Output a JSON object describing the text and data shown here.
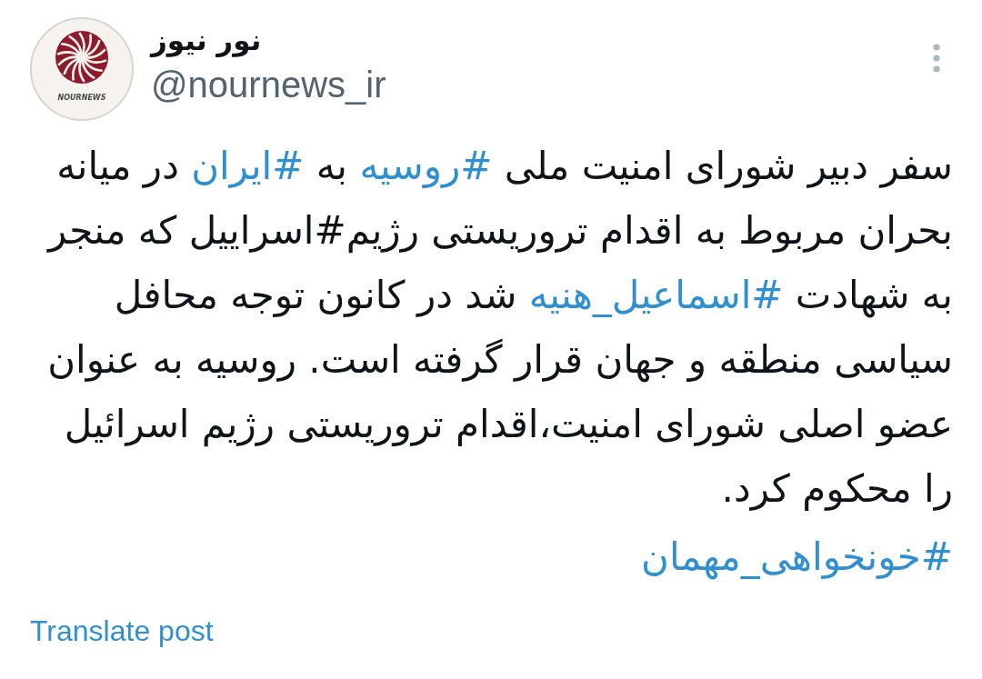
{
  "author": {
    "name": "نور نیوز",
    "handle": "@nournews_ir",
    "avatar": {
      "logo_text": "NOURNEWS"
    }
  },
  "post": {
    "lines": [
      [
        {
          "kind": "text",
          "text": "سفر دبیر شورای امنیت ملی "
        },
        {
          "kind": "hashtag",
          "text": "#روسیه"
        },
        {
          "kind": "text",
          "text": " به "
        },
        {
          "kind": "hashtag",
          "text": "#ایران"
        },
        {
          "kind": "text",
          "text": " در میانه"
        }
      ],
      [
        {
          "kind": "text",
          "text": "بحران مربوط به اقدام تروریستی رژیم#اسراییل که منجر"
        }
      ],
      [
        {
          "kind": "text",
          "text": "به شهادت "
        },
        {
          "kind": "hashtag",
          "text": "#اسماعیل_هنیه"
        },
        {
          "kind": "text",
          "text": " شد در کانون توجه محافل"
        }
      ],
      [
        {
          "kind": "text",
          "text": "سیاسی منطقه و جهان قرار گرفته است. روسیه به عنوان"
        }
      ],
      [
        {
          "kind": "text",
          "text": "عضو اصلی شورای امنیت،اقدام تروریستی رژیم اسرائیل"
        }
      ],
      [
        {
          "kind": "text",
          "text": "را محکوم کرد."
        }
      ]
    ],
    "hashtags": [
      "#خونخواهی_مهمان"
    ]
  },
  "translate_link": "Translate post"
}
